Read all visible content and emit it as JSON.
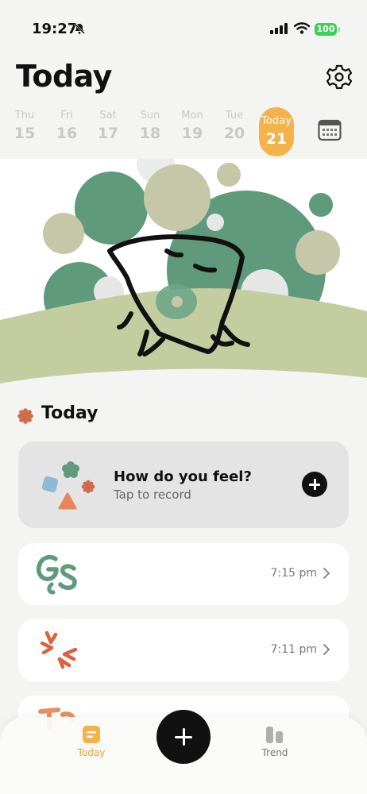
{
  "status_bar": {
    "time": "19:27",
    "battery": "100"
  },
  "header": {
    "title": "Today"
  },
  "week": [
    {
      "name": "Thu",
      "num": "15"
    },
    {
      "name": "Fri",
      "num": "16"
    },
    {
      "name": "Sat",
      "num": "17"
    },
    {
      "name": "Sun",
      "num": "18"
    },
    {
      "name": "Mon",
      "num": "19"
    },
    {
      "name": "Tue",
      "num": "20"
    },
    {
      "name": "Today",
      "num": "21"
    }
  ],
  "section": {
    "title": "Today"
  },
  "record_card": {
    "question": "How do you feel?",
    "subtitle": "Tap to record"
  },
  "entries": [
    {
      "time": "7:15 pm",
      "icon": "gs-mood-icon"
    },
    {
      "time": "7:11 pm",
      "icon": "burst-mood-icon"
    }
  ],
  "tabbar": {
    "today_label": "Today",
    "trend_label": "Trend"
  },
  "colors": {
    "accent": "#f3b24a",
    "green": "#5f9a7c",
    "sage": "#c5c7a8",
    "hill": "#c4cda0",
    "orange": "#e46a3f"
  }
}
